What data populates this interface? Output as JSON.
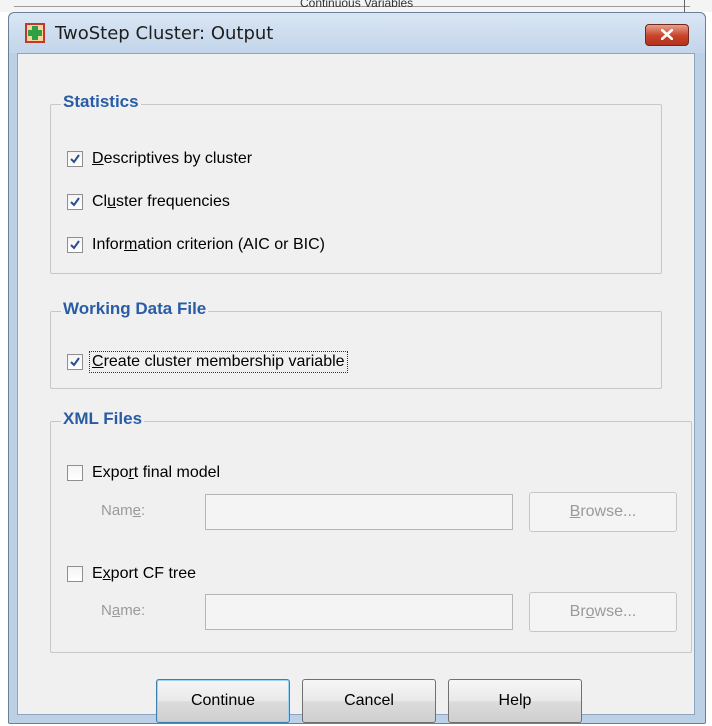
{
  "background": {
    "partial_text": "Continuous Variables"
  },
  "dialog": {
    "title": "TwoStep Cluster: Output"
  },
  "statistics": {
    "legend": "Statistics",
    "descriptives": {
      "pre": "",
      "key": "D",
      "post": "escriptives by cluster",
      "checked": true
    },
    "frequencies": {
      "pre": "Cl",
      "key": "u",
      "post": "ster frequencies",
      "checked": true
    },
    "information": {
      "pre": "Infor",
      "key": "m",
      "post": "ation criterion (AIC or BIC)",
      "checked": true
    }
  },
  "working": {
    "legend": "Working Data File",
    "create": {
      "pre": "",
      "key": "C",
      "post": "reate cluster membership variable",
      "checked": true
    }
  },
  "xml": {
    "legend": "XML Files",
    "export_final": {
      "pre": "Expo",
      "key": "r",
      "post": "t final model",
      "checked": false
    },
    "name1": {
      "pre": "Nam",
      "key": "e",
      "post": ":"
    },
    "browse1": {
      "pre": "",
      "key": "B",
      "post": "rowse..."
    },
    "export_cf": {
      "pre": "E",
      "key": "x",
      "post": "port CF tree",
      "checked": false
    },
    "name2": {
      "pre": "N",
      "key": "a",
      "post": "me:"
    },
    "browse2": {
      "pre": "Br",
      "key": "o",
      "post": "wse..."
    }
  },
  "buttons": {
    "continue": "Continue",
    "cancel": "Cancel",
    "help": "Help"
  },
  "colors": {
    "legend": "#2a5ca6",
    "close": "#c7432a",
    "title_bar": "#c3d5ea"
  }
}
